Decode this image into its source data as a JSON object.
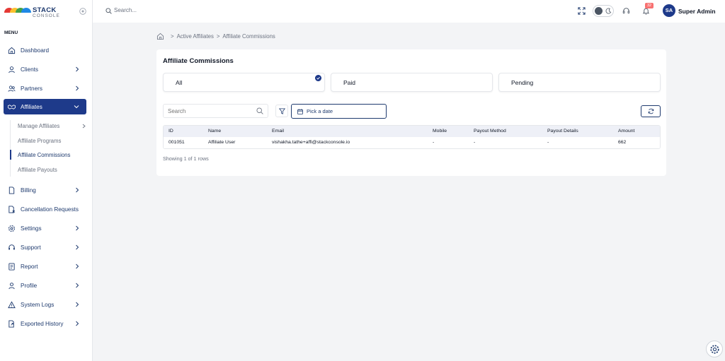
{
  "brand": {
    "name": "STACK",
    "sub": "CONSOLE"
  },
  "sidebar": {
    "menu_label": "MENU",
    "items": [
      {
        "label": "Dashboard",
        "icon": "home-icon",
        "has_children": false
      },
      {
        "label": "Clients",
        "icon": "user-icon",
        "has_children": true
      },
      {
        "label": "Partners",
        "icon": "users-icon",
        "has_children": true
      },
      {
        "label": "Affiliates",
        "icon": "handshake-icon",
        "has_children": true,
        "active": true
      },
      {
        "label": "Billing",
        "icon": "file-icon",
        "has_children": true
      },
      {
        "label": "Cancellation Requests",
        "icon": "document-cancel-icon",
        "has_children": false
      },
      {
        "label": "Settings",
        "icon": "gear-icon",
        "has_children": true
      },
      {
        "label": "Support",
        "icon": "headset-icon",
        "has_children": true
      },
      {
        "label": "Report",
        "icon": "report-icon",
        "has_children": true
      },
      {
        "label": "Profile",
        "icon": "profile-icon",
        "has_children": true
      },
      {
        "label": "System Logs",
        "icon": "warning-icon",
        "has_children": true
      },
      {
        "label": "Exported History",
        "icon": "export-icon",
        "has_children": true
      }
    ],
    "affiliate_subitems": [
      {
        "label": "Manage Affiliates",
        "has_children": true
      },
      {
        "label": "Affiliate Programs"
      },
      {
        "label": "Affiliate Commissions",
        "current": true
      },
      {
        "label": "Affiliate Payouts"
      }
    ]
  },
  "header": {
    "search_placeholder": "Search...",
    "notification_count": "32",
    "avatar_initials": "SA",
    "user_name": "Super Admin"
  },
  "breadcrumb": [
    "Active Affiliates",
    "Affiliate Commissions"
  ],
  "page": {
    "title": "Affiliate Commissions",
    "tabs": [
      {
        "label": "All",
        "selected": true
      },
      {
        "label": "Paid",
        "selected": false
      },
      {
        "label": "Pending",
        "selected": false
      }
    ],
    "search_placeholder": "Search",
    "date_placeholder": "Pick a date",
    "table": {
      "columns": [
        "ID",
        "Name",
        "Email",
        "Mobile",
        "Payout Method",
        "Payout Details",
        "Amount"
      ],
      "rows": [
        [
          "001051",
          "Affiliate User",
          "vishakha.tathe+affi@stackconsole.io",
          "-",
          "-",
          "-",
          "662"
        ]
      ]
    },
    "showing_text": "Showing 1 of 1 rows"
  },
  "colors": {
    "primary": "#1e3a8a",
    "badge": "#f87171",
    "page_bg": "#f3f4f6"
  }
}
